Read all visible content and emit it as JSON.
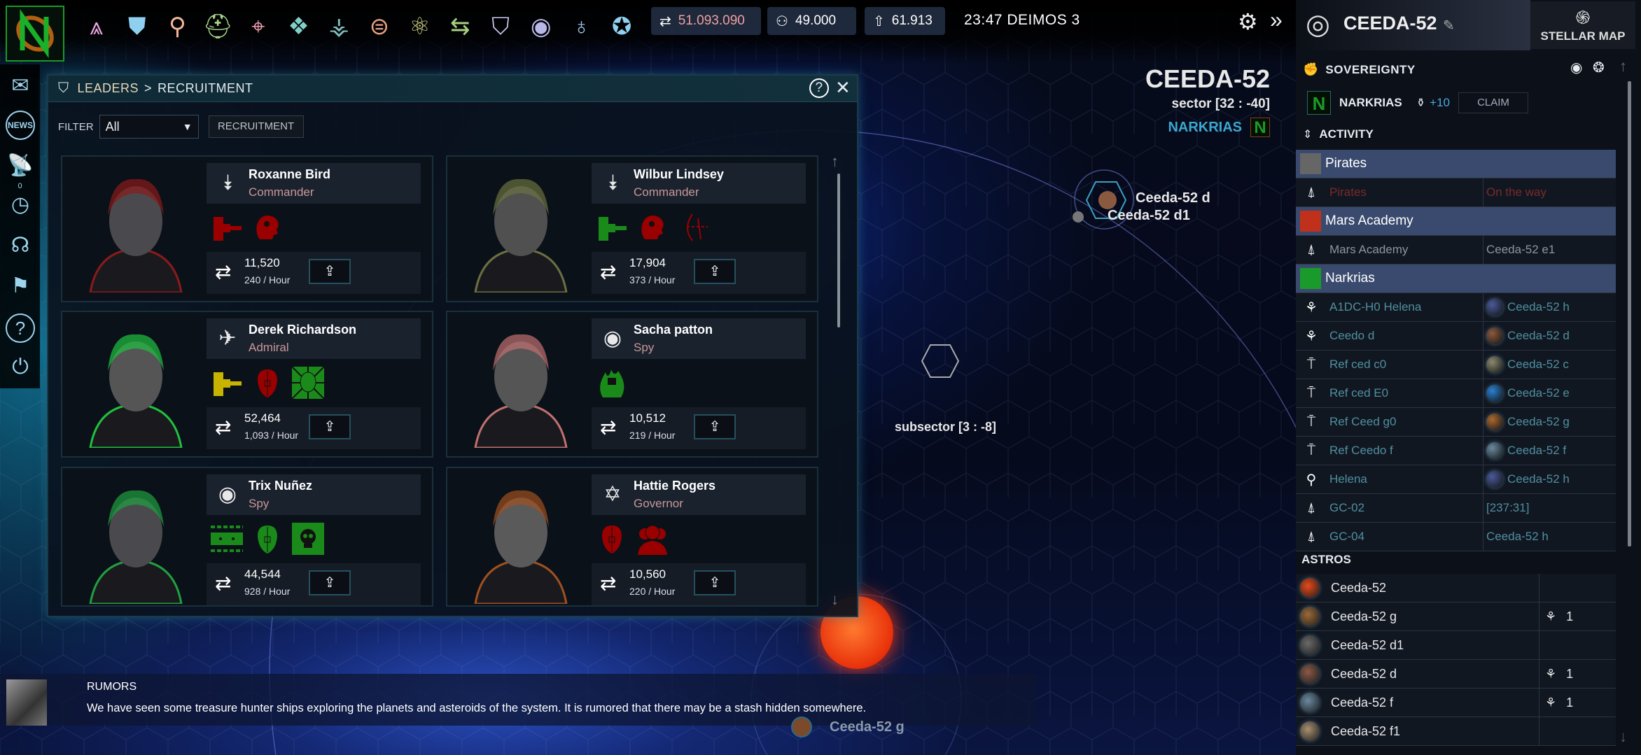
{
  "topbar": {
    "icons": [
      {
        "name": "fleet-icon",
        "glyph": "⩓",
        "color": "#e8a8e0"
      },
      {
        "name": "armor-icon",
        "glyph": "⛊",
        "color": "#8fd0f0"
      },
      {
        "name": "leader-head-icon",
        "glyph": "⚲",
        "color": "#f5b89a"
      },
      {
        "name": "helmet-icon",
        "glyph": "⛑",
        "color": "#a8d88a"
      },
      {
        "name": "target-icon",
        "glyph": "⌖",
        "color": "#f0a0b0"
      },
      {
        "name": "network-icon",
        "glyph": "❖",
        "color": "#7fd0c8"
      },
      {
        "name": "tech-tree-icon",
        "glyph": "⚶",
        "color": "#80c0c0"
      },
      {
        "name": "planet-market-icon",
        "glyph": "⊜",
        "color": "#e8a080"
      },
      {
        "name": "research-atom-icon",
        "glyph": "⚛",
        "color": "#d8d88a"
      },
      {
        "name": "trade-arrows-icon",
        "glyph": "⇆",
        "color": "#a8d080"
      },
      {
        "name": "leaders-icon",
        "glyph": "⛉",
        "color": "#c8c8f0"
      },
      {
        "name": "spy-eye-icon",
        "glyph": "◉",
        "color": "#b8b8e8"
      },
      {
        "name": "planet-icon",
        "glyph": "♁",
        "color": "#a0c8f0"
      },
      {
        "name": "medal-icon",
        "glyph": "✪",
        "color": "#90d0f0"
      }
    ],
    "resources": [
      {
        "name": "credits",
        "icon": "⇄",
        "value": "51.093.090",
        "color": "#f0a0a0"
      },
      {
        "name": "population",
        "icon": "⚇",
        "value": "49.000",
        "color": "#ffffff"
      },
      {
        "name": "fleet-points",
        "icon": "⇧",
        "value": "61.913",
        "color": "#ffffff"
      }
    ],
    "clock": "23:47 DEIMOS 3",
    "settings_icon": "⚙",
    "expand_icon": "»"
  },
  "sidebar": {
    "items": [
      {
        "name": "mail",
        "glyph": "✉"
      },
      {
        "name": "news",
        "glyph": "NEWS"
      },
      {
        "name": "radar",
        "glyph": "📡"
      },
      {
        "name": "timer",
        "glyph": "◷",
        "badge": "0"
      },
      {
        "name": "support",
        "glyph": "☊"
      },
      {
        "name": "flag",
        "glyph": "⚑"
      },
      {
        "name": "help",
        "glyph": "?"
      },
      {
        "name": "power",
        "glyph": "⏻"
      }
    ]
  },
  "recruitment": {
    "breadcrumb_root": "LEADERS",
    "breadcrumb_sep": ">",
    "breadcrumb_current": "RECRUITMENT",
    "help": "?",
    "close": "✕",
    "filter_label": "FILTER",
    "filter_value": "All",
    "recruitment_button": "RECRUITMENT",
    "hire_icon": "⇪",
    "cycle_icon": "⇄",
    "leaders": [
      {
        "name": "Roxanne Bird",
        "role": "Commander",
        "rank": "commander",
        "cost": "11,520",
        "rate": "240 / Hour",
        "skin": "#4a4a4e",
        "accent": "#8a1a1a",
        "skills": [
          {
            "type": "turret",
            "color": "#9a0000"
          },
          {
            "type": "head-gear",
            "color": "#9a0000"
          }
        ]
      },
      {
        "name": "Wilbur Lindsey",
        "role": "Commander",
        "rank": "commander",
        "cost": "17,904",
        "rate": "373 / Hour",
        "skin": "#505050",
        "accent": "#6a7040",
        "skills": [
          {
            "type": "turret",
            "color": "#1a8a1a"
          },
          {
            "type": "head-gear",
            "color": "#9a0000"
          },
          {
            "type": "archer",
            "color": "#9a0000"
          }
        ]
      },
      {
        "name": "Derek Richardson",
        "role": "Admiral",
        "rank": "admiral",
        "cost": "52,464",
        "rate": "1,093 / Hour",
        "skin": "#555",
        "accent": "#20c040",
        "skills": [
          {
            "type": "turret",
            "color": "#c8b400"
          },
          {
            "type": "split-head",
            "color": "#9a0000"
          },
          {
            "type": "radiant-head",
            "color": "#1a8a1a"
          }
        ]
      },
      {
        "name": "Sacha patton",
        "role": "Spy",
        "rank": "spy",
        "cost": "10,512",
        "rate": "219 / Hour",
        "skin": "#555",
        "accent": "#c07070",
        "skills": [
          {
            "type": "flame-fist",
            "color": "#1a8a1a"
          }
        ]
      },
      {
        "name": "Trix Nuñez",
        "role": "Spy",
        "rank": "spy",
        "cost": "44,544",
        "rate": "928 / Hour",
        "skin": "#4a4a4e",
        "accent": "#20a040",
        "skills": [
          {
            "type": "circuit",
            "color": "#1a8a1a"
          },
          {
            "type": "split-head",
            "color": "#1a8a1a"
          },
          {
            "type": "skull",
            "color": "#1a8a1a"
          }
        ]
      },
      {
        "name": "Hattie Rogers",
        "role": "Governor",
        "rank": "governor",
        "cost": "10,560",
        "rate": "220 / Hour",
        "skin": "#5a5a5a",
        "accent": "#a05020",
        "skills": [
          {
            "type": "split-head",
            "color": "#9a0000"
          },
          {
            "type": "group",
            "color": "#9a0000"
          }
        ]
      }
    ]
  },
  "map": {
    "system_title": "CEEDA-52",
    "sector": "sector [32 : -40]",
    "owner": "NARKRIAS",
    "subsector": "subsector [3 : -8]",
    "labels": {
      "d": "Ceeda-52 d",
      "d1": "Ceeda-52 d1",
      "g": "Ceeda-52 g"
    }
  },
  "rumors": {
    "title": "RUMORS",
    "text": "We have seen some treasure hunter ships exploring the planets and asteroids of the system. It is rumored that there may be a stash hidden somewhere."
  },
  "right_panel": {
    "system_name": "CEEDA-52",
    "edit_icon": "✎",
    "stellar_map": "STELLAR MAP",
    "sovereignty": "SOVEREIGNTY",
    "owner": "NARKRIAS",
    "influence": "+10",
    "claim": "CLAIM",
    "activity": "ACTIVITY",
    "activity_groups": [
      {
        "group": "Pirates",
        "logo_color": "#666",
        "rows": [
          {
            "icon": "fleet",
            "name": "Pirates",
            "location": "On the way",
            "color": "#7a2a2a"
          }
        ]
      },
      {
        "group": "Mars Academy",
        "logo_color": "#c0301a",
        "rows": [
          {
            "icon": "fleet",
            "name": "Mars Academy",
            "location": "Ceeda-52 e1",
            "color": "#8a96a0"
          }
        ]
      },
      {
        "group": "Narkrias",
        "logo_color": "#1a9a2a",
        "rows": [
          {
            "icon": "station",
            "name": "A1DC-H0 Helena",
            "location": "Ceeda-52 h",
            "planet": "#4a5a9a",
            "color": "#4f8fa0"
          },
          {
            "icon": "station",
            "name": "Ceedo d",
            "location": "Ceeda-52 d",
            "planet": "#8a5a40",
            "color": "#4f8fa0"
          },
          {
            "icon": "refinery",
            "name": "Ref ced c0",
            "location": "Ceeda-52 c",
            "planet": "#8a8a70",
            "color": "#4f8fa0"
          },
          {
            "icon": "refinery",
            "name": "Ref ced E0",
            "location": "Ceeda-52 e",
            "planet": "#2a80d0",
            "color": "#4f8fa0"
          },
          {
            "icon": "refinery",
            "name": "Ref Ceed g0",
            "location": "Ceeda-52 g",
            "planet": "#a86a30",
            "color": "#4f8fa0"
          },
          {
            "icon": "refinery",
            "name": "Ref Ceedo f",
            "location": "Ceeda-52 f",
            "planet": "#6a8aa0",
            "color": "#4f8fa0"
          },
          {
            "icon": "leader",
            "name": "Helena",
            "location": "Ceeda-52 h",
            "planet": "#4a5a9a",
            "color": "#4f8fa0"
          },
          {
            "icon": "fleet",
            "name": "GC-02",
            "location": "[237:31]",
            "color": "#4f8fa0"
          },
          {
            "icon": "fleet",
            "name": "GC-04",
            "location": "Ceeda-52 h",
            "color": "#4f8fa0"
          }
        ]
      }
    ],
    "astros_title": "ASTROS",
    "astros": [
      {
        "name": "Ceeda-52",
        "color": "#e84a1a",
        "stations": ""
      },
      {
        "name": "Ceeda-52 g",
        "color": "#9a6a3a",
        "stations": "1"
      },
      {
        "name": "Ceeda-52 d1",
        "color": "#6a6a6a",
        "stations": ""
      },
      {
        "name": "Ceeda-52 d",
        "color": "#8a5a48",
        "stations": "1"
      },
      {
        "name": "Ceeda-52 f",
        "color": "#6a8aa0",
        "stations": "1"
      },
      {
        "name": "Ceeda-52 f1",
        "color": "#a89070",
        "stations": ""
      }
    ]
  }
}
